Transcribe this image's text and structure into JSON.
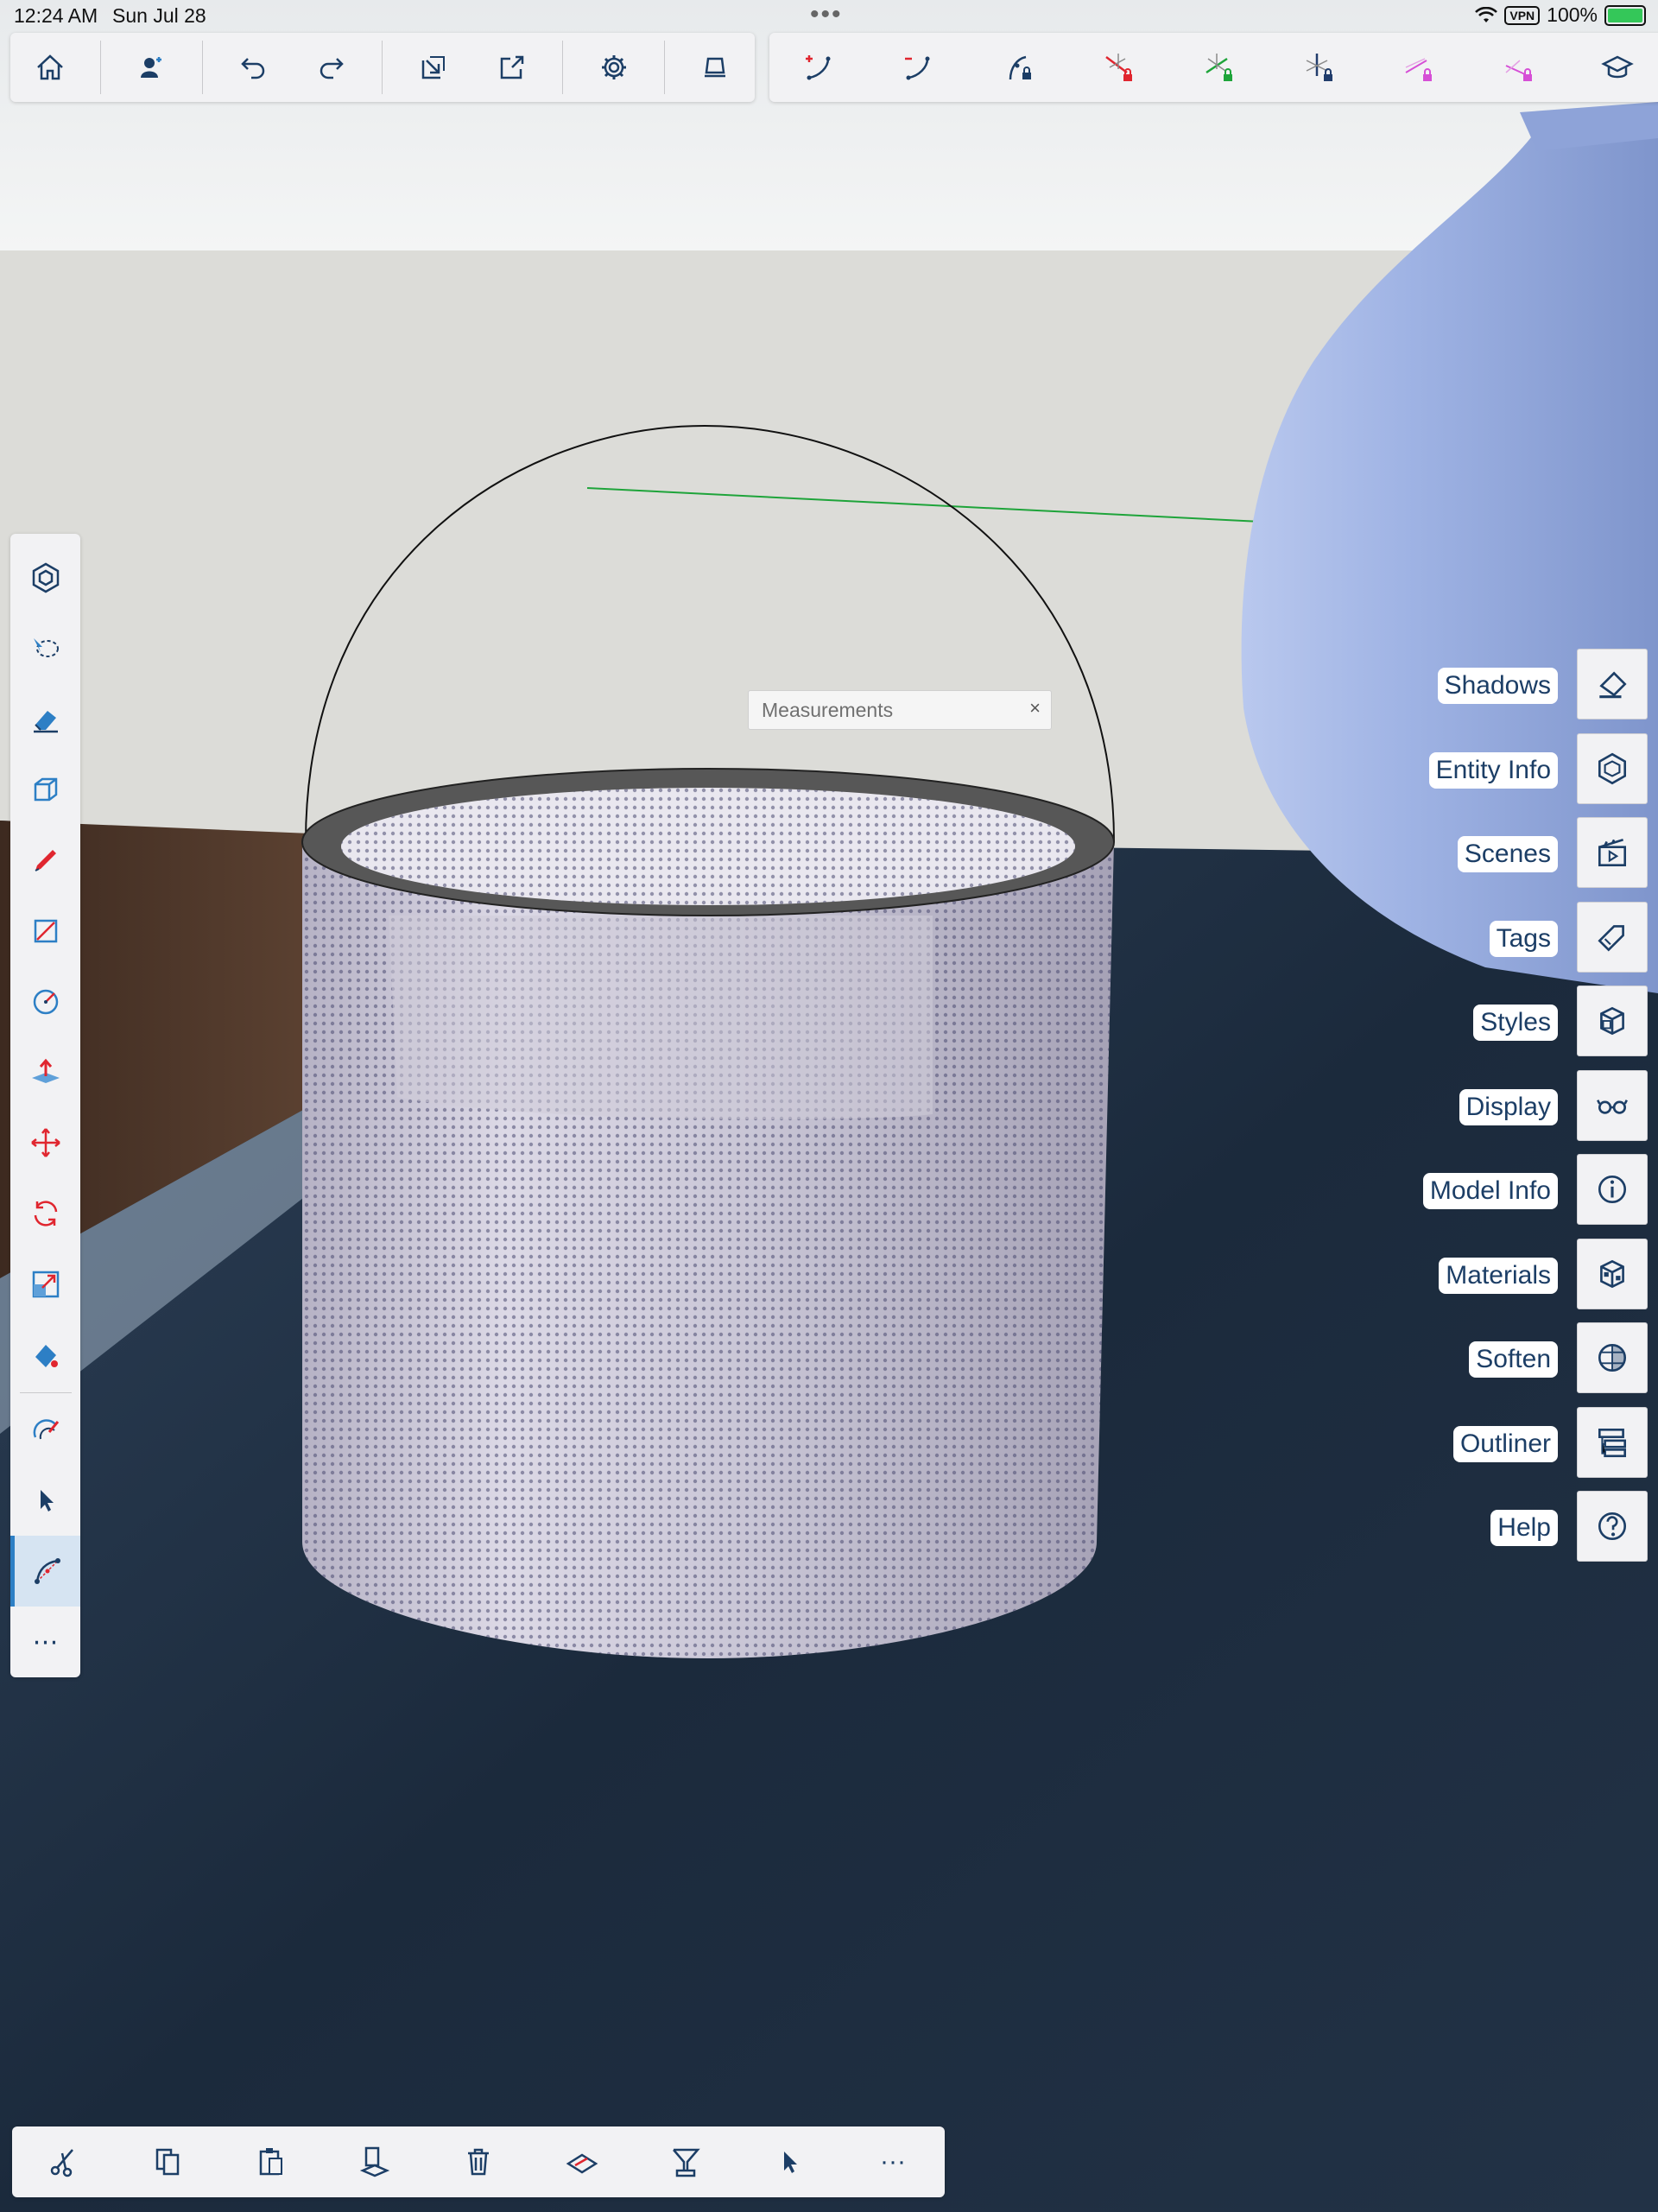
{
  "status_bar": {
    "time": "12:24 AM",
    "date": "Sun Jul 28",
    "multitask_dots": "•••",
    "vpn": "VPN",
    "battery": "100%"
  },
  "top_toolbar_left": [
    {
      "name": "home",
      "icon": "home-icon"
    },
    {
      "name": "account",
      "icon": "person-plus-icon"
    },
    {
      "name": "undo",
      "icon": "undo-icon"
    },
    {
      "name": "redo",
      "icon": "redo-icon"
    },
    {
      "name": "import",
      "icon": "import-icon"
    },
    {
      "name": "export",
      "icon": "export-icon"
    },
    {
      "name": "settings",
      "icon": "gear-icon"
    },
    {
      "name": "view",
      "icon": "view-tray-icon"
    }
  ],
  "top_toolbar_right": [
    {
      "name": "add-control-point",
      "icon": "curve-plus-icon"
    },
    {
      "name": "remove-control-point",
      "icon": "curve-minus-icon"
    },
    {
      "name": "lock-curve",
      "icon": "curve-lock-icon"
    },
    {
      "name": "lock-red-axis",
      "icon": "red-axis-lock-icon"
    },
    {
      "name": "lock-green-axis",
      "icon": "green-axis-lock-icon"
    },
    {
      "name": "lock-blue-axis",
      "icon": "blue-axis-lock-icon"
    },
    {
      "name": "lock-magenta-1",
      "icon": "magenta-line-lock-icon"
    },
    {
      "name": "lock-magenta-2",
      "icon": "magenta-line-lock-2-icon"
    },
    {
      "name": "more-tools",
      "icon": "graduation-cap-icon"
    }
  ],
  "left_toolbar": [
    {
      "name": "components",
      "icon": "components-icon"
    },
    {
      "name": "lasso",
      "icon": "lasso-icon"
    },
    {
      "name": "eraser",
      "icon": "eraser-icon"
    },
    {
      "name": "box",
      "icon": "box-icon"
    },
    {
      "name": "pencil",
      "icon": "pencil-icon"
    },
    {
      "name": "rectangle",
      "icon": "rectangle-icon"
    },
    {
      "name": "circle",
      "icon": "circle-icon"
    },
    {
      "name": "push-pull",
      "icon": "push-pull-icon"
    },
    {
      "name": "move",
      "icon": "move-icon"
    },
    {
      "name": "rotate",
      "icon": "rotate-icon"
    },
    {
      "name": "scale",
      "icon": "scale-icon"
    },
    {
      "name": "paint",
      "icon": "paint-bucket-icon"
    },
    {
      "name": "follow-me",
      "icon": "follow-me-icon"
    },
    {
      "name": "select",
      "icon": "arrow-select-icon"
    },
    {
      "name": "curve-edit",
      "icon": "curve-edit-icon",
      "active": true
    },
    {
      "name": "more",
      "icon": "ellipsis-icon",
      "label": "⋯"
    }
  ],
  "measurements": {
    "label": "Measurements",
    "close": "×"
  },
  "side_panel": [
    {
      "label": "Shadows",
      "icon": "shadows-icon"
    },
    {
      "label": "Entity Info",
      "icon": "entity-info-icon"
    },
    {
      "label": "Scenes",
      "icon": "clapperboard-icon"
    },
    {
      "label": "Tags",
      "icon": "tag-icon"
    },
    {
      "label": "Styles",
      "icon": "styles-cube-icon"
    },
    {
      "label": "Display",
      "icon": "glasses-icon"
    },
    {
      "label": "Model Info",
      "icon": "info-icon"
    },
    {
      "label": "Materials",
      "icon": "materials-cube-icon"
    },
    {
      "label": "Soften",
      "icon": "soften-sphere-icon"
    },
    {
      "label": "Outliner",
      "icon": "outliner-icon"
    },
    {
      "label": "Help",
      "icon": "help-icon"
    }
  ],
  "bottom_toolbar": [
    {
      "name": "cut",
      "icon": "scissors-icon"
    },
    {
      "name": "copy",
      "icon": "copy-icon"
    },
    {
      "name": "paste",
      "icon": "paste-icon"
    },
    {
      "name": "paste-in-place",
      "icon": "paste-in-place-icon"
    },
    {
      "name": "delete",
      "icon": "trash-icon"
    },
    {
      "name": "make-group",
      "icon": "group-icon"
    },
    {
      "name": "make-component",
      "icon": "component-stamp-icon"
    },
    {
      "name": "select-mode",
      "icon": "cursor-icon"
    },
    {
      "name": "more",
      "icon": "ellipsis-icon",
      "label": "···"
    }
  ],
  "colors": {
    "ui_blue": "#1c3e66",
    "accent_blue": "#2d7fc5",
    "red_axis": "#e0262f",
    "green_axis": "#1ea43a",
    "blue_axis": "#213d6c",
    "magenta": "#d64fd6",
    "vase": "#a9bce7",
    "wall": "#dcdcd8",
    "sky": "#eef0f1",
    "floor": "#1d2c3f",
    "table": "#4c3528"
  }
}
